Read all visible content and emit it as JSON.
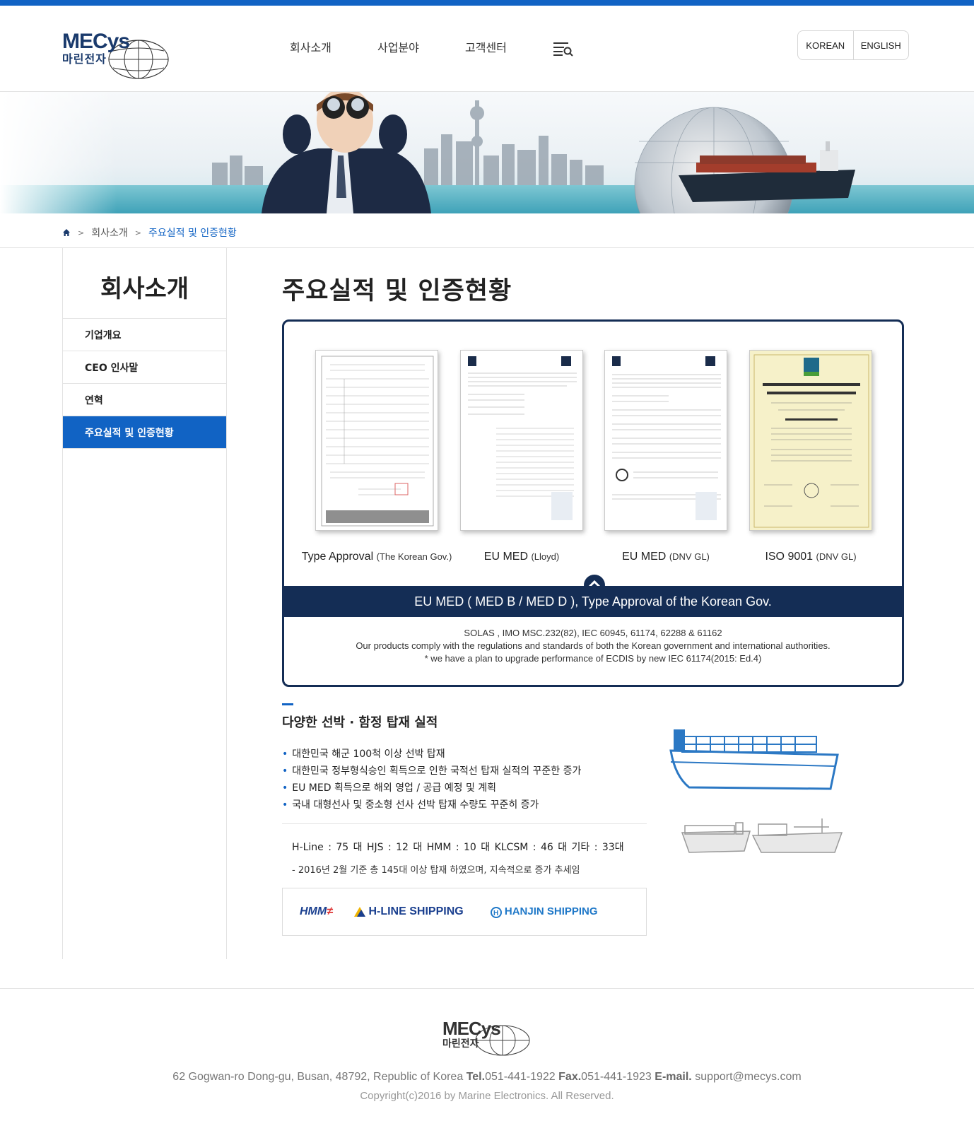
{
  "header": {
    "logo_en": "MECys",
    "logo_ko": "마린전자",
    "nav": [
      "회사소개",
      "사업분야",
      "고객센터"
    ],
    "menu_icon": "menu-search-icon",
    "lang": [
      "KOREAN",
      "ENGLISH"
    ]
  },
  "breadcrumb": {
    "home_icon": "home-icon",
    "sep": ">",
    "items": [
      "회사소개",
      "주요실적 및 인증현황"
    ]
  },
  "sidebar": {
    "title": "회사소개",
    "items": [
      "기업개요",
      "CEO 인사말",
      "연혁",
      "주요실적 및 인증현황"
    ],
    "active_index": 3
  },
  "main": {
    "title": "주요실적 및 인증현황",
    "certs": [
      {
        "name": "Type Approval",
        "issuer": "(The Korean Gov.)"
      },
      {
        "name": "EU MED",
        "issuer": "(Lloyd)"
      },
      {
        "name": "EU MED",
        "issuer": "(DNV GL)"
      },
      {
        "name": "ISO 9001",
        "issuer": "(DNV GL)"
      }
    ],
    "band": "EU MED ( MED B / MED D ), Type Approval of the Korean Gov.",
    "notes": [
      "SOLAS , IMO MSC.232(82), IEC 60945, 61174, 62288 & 61162",
      "Our products comply with the regulations and standards of both the Korean government and international authorities.",
      "* we have a plan to upgrade performance of ECDIS by new IEC 61174(2015: Ed.4)"
    ],
    "section_title": "다양한 선박 · 함정 탑재 실적",
    "bullets": [
      "대한민국 해군 100척 이상 선박 탑재",
      "대한민국 정부형식승인 획득으로 인한 국적선 탑재 실적의 꾸준한 증가",
      "EU MED 획득으로 해외 영업 / 공급 예정 및 계획",
      "국내 대형선사 및 중소형 선사 선박 탑재 수량도 꾸준히 증가"
    ],
    "stats": "H-Line : 75 대   HJS : 12 대   HMM : 10 대   KLCSM : 46 대   기타 : 33대",
    "stats_note": "- 2016년 2월 기준 총 145대 이상 탑재 하였으며, 지속적으로 증가 추세임",
    "partners": [
      "HMM",
      "H-LINE SHIPPING",
      "HANJIN SHIPPING"
    ]
  },
  "footer": {
    "logo_en": "MECys",
    "logo_ko": "마린전자",
    "address": "62 Gogwan-ro Dong-gu, Busan, 48792, Republic of Korea",
    "tel_label": "Tel.",
    "tel": "051-441-1922",
    "fax_label": "Fax.",
    "fax": "051-441-1923",
    "email_label": "E-mail.",
    "email": "support@mecys.com",
    "copyright": "Copyright(c)2016 by Marine Electronics. All Reserved."
  },
  "colors": {
    "accent": "#1163c4",
    "navy": "#142d55"
  }
}
